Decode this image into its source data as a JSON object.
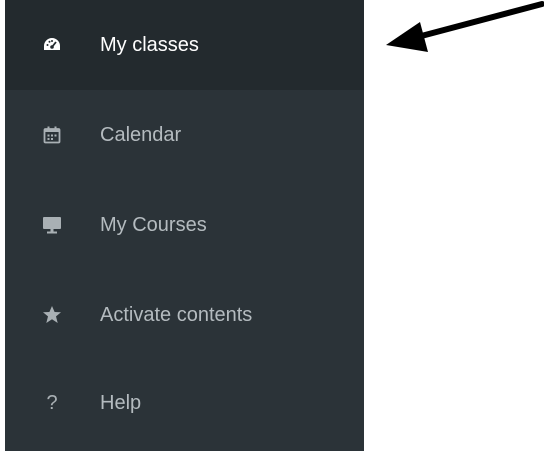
{
  "sidebar": {
    "items": [
      {
        "label": "My classes",
        "icon": "dashboard-icon",
        "active": true
      },
      {
        "label": "Calendar",
        "icon": "calendar-icon",
        "active": false
      },
      {
        "label": "My Courses",
        "icon": "monitor-icon",
        "active": false
      },
      {
        "label": "Activate contents",
        "icon": "star-icon",
        "active": false
      },
      {
        "label": "Help",
        "icon": "question-icon",
        "active": false
      }
    ],
    "help_glyph": "?"
  },
  "annotation": {
    "icon": "arrow-pointer-icon"
  },
  "colors": {
    "sidebar_bg": "#2b3338",
    "active_bg": "#232a2e",
    "active_text": "#ffffff",
    "inactive_text": "#b4bbbf"
  }
}
